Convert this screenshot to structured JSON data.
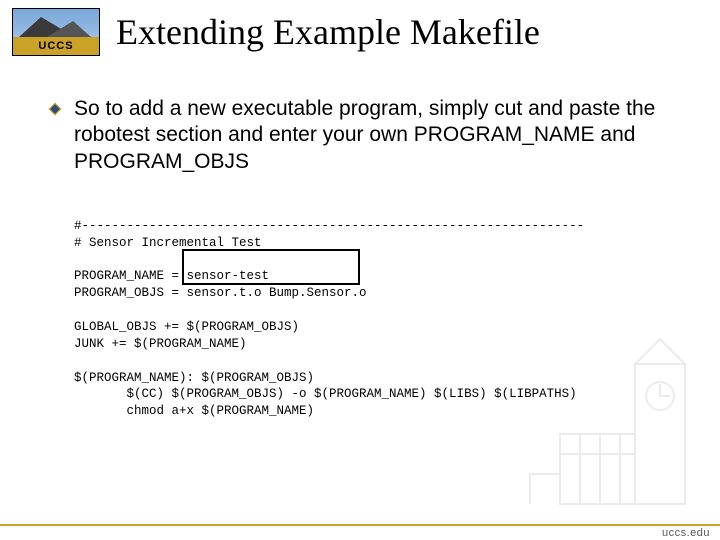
{
  "logo": {
    "text": "UCCS"
  },
  "title": "Extending Example Makefile",
  "bullet": "So to add a new executable program, simply cut and paste the robotest section and enter your own PROGRAM_NAME and PROGRAM_OBJS",
  "code": {
    "l1": "#-------------------------------------------------------------------",
    "l2": "# Sensor Incremental Test",
    "l3": "",
    "l4": "PROGRAM_NAME = sensor-test",
    "l5": "PROGRAM_OBJS = sensor.t.o Bump.Sensor.o",
    "l6": "",
    "l7": "GLOBAL_OBJS += $(PROGRAM_OBJS)",
    "l8": "JUNK += $(PROGRAM_NAME)",
    "l9": "",
    "l10": "$(PROGRAM_NAME): $(PROGRAM_OBJS)",
    "l11": "       $(CC) $(PROGRAM_OBJS) -o $(PROGRAM_NAME) $(LIBS) $(LIBPATHS)",
    "l12": "       chmod a+x $(PROGRAM_NAME)"
  },
  "footer": {
    "url": "uccs.edu"
  }
}
